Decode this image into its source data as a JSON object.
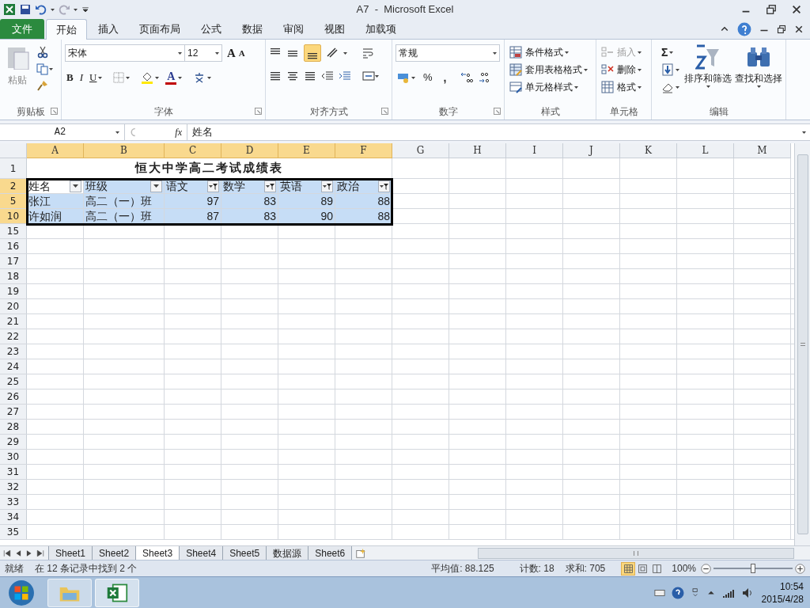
{
  "window": {
    "title": "A7  -  Microsoft Excel"
  },
  "file_tab": "文件",
  "tabs": [
    {
      "label": "开始",
      "selected": true
    },
    {
      "label": "插入",
      "selected": false
    },
    {
      "label": "页面布局",
      "selected": false
    },
    {
      "label": "公式",
      "selected": false
    },
    {
      "label": "数据",
      "selected": false
    },
    {
      "label": "审阅",
      "selected": false
    },
    {
      "label": "视图",
      "selected": false
    },
    {
      "label": "加载项",
      "selected": false
    }
  ],
  "ribbon": {
    "clipboard": {
      "label": "剪贴板",
      "paste": "粘贴"
    },
    "font": {
      "label": "字体",
      "font_name": "宋体",
      "font_size": "12",
      "grow": "A",
      "shrink": "A",
      "bold": "B",
      "italic": "I",
      "underline": "U",
      "font_color": "A"
    },
    "alignment": {
      "label": "对齐方式"
    },
    "number": {
      "label": "数字",
      "format": "常规",
      "percent": "%",
      "comma": ","
    },
    "styles": {
      "label": "样式",
      "items": [
        "条件格式",
        "套用表格格式",
        "单元格样式"
      ]
    },
    "cells": {
      "label": "单元格",
      "items": [
        {
          "label": "插入",
          "disabled": true
        },
        {
          "label": "删除",
          "disabled": false
        },
        {
          "label": "格式",
          "disabled": false
        }
      ]
    },
    "editing": {
      "label": "编辑",
      "sum": "Σ",
      "sort_filter": "排序和筛选",
      "find_select": "查找和选择"
    }
  },
  "formula_bar": {
    "name_box": "A2",
    "fx": "fx",
    "formula": "姓名"
  },
  "sheet": {
    "columns": [
      {
        "label": "A",
        "selected": true
      },
      {
        "label": "B",
        "selected": true
      },
      {
        "label": "C",
        "selected": true
      },
      {
        "label": "D",
        "selected": true
      },
      {
        "label": "E",
        "selected": true
      },
      {
        "label": "F",
        "selected": true
      },
      {
        "label": "G",
        "selected": false
      },
      {
        "label": "H",
        "selected": false
      },
      {
        "label": "I",
        "selected": false
      },
      {
        "label": "J",
        "selected": false
      },
      {
        "label": "K",
        "selected": false
      },
      {
        "label": "L",
        "selected": false
      },
      {
        "label": "M",
        "selected": false
      }
    ],
    "rows": [
      {
        "header": "1",
        "kind": "title",
        "selected": false,
        "title": "恒大中学高二考试成绩表"
      },
      {
        "header": "2",
        "kind": "header",
        "selected": true,
        "cells": [
          {
            "text": "姓名",
            "filtered": false,
            "active": true
          },
          {
            "text": "班级",
            "filtered": false,
            "active": false
          },
          {
            "text": "语文",
            "filtered": true,
            "active": false
          },
          {
            "text": "数学",
            "filtered": true,
            "active": false
          },
          {
            "text": "英语",
            "filtered": true,
            "active": false
          },
          {
            "text": "政治",
            "filtered": true,
            "active": false
          }
        ]
      },
      {
        "header": "5",
        "kind": "data",
        "selected": true,
        "cells": [
          {
            "text": "张江",
            "numeric": false
          },
          {
            "text": "高二（一）班",
            "numeric": false
          },
          {
            "text": "97",
            "numeric": true
          },
          {
            "text": "83",
            "numeric": true
          },
          {
            "text": "89",
            "numeric": true
          },
          {
            "text": "88",
            "numeric": true
          }
        ]
      },
      {
        "header": "10",
        "kind": "data",
        "selected": true,
        "cells": [
          {
            "text": "许如润",
            "numeric": false
          },
          {
            "text": "高二（一）班",
            "numeric": false
          },
          {
            "text": "87",
            "numeric": true
          },
          {
            "text": "83",
            "numeric": true
          },
          {
            "text": "90",
            "numeric": true
          },
          {
            "text": "88",
            "numeric": true
          }
        ]
      },
      {
        "header": "15",
        "kind": "empty",
        "selected": false
      },
      {
        "header": "16",
        "kind": "empty",
        "selected": false
      },
      {
        "header": "17",
        "kind": "empty",
        "selected": false
      },
      {
        "header": "18",
        "kind": "empty",
        "selected": false
      },
      {
        "header": "19",
        "kind": "empty",
        "selected": false
      },
      {
        "header": "20",
        "kind": "empty",
        "selected": false
      },
      {
        "header": "21",
        "kind": "empty",
        "selected": false
      },
      {
        "header": "22",
        "kind": "empty",
        "selected": false
      },
      {
        "header": "23",
        "kind": "empty",
        "selected": false
      },
      {
        "header": "24",
        "kind": "empty",
        "selected": false
      },
      {
        "header": "25",
        "kind": "empty",
        "selected": false
      },
      {
        "header": "26",
        "kind": "empty",
        "selected": false
      },
      {
        "header": "27",
        "kind": "empty",
        "selected": false
      },
      {
        "header": "28",
        "kind": "empty",
        "selected": false
      },
      {
        "header": "29",
        "kind": "empty",
        "selected": false
      },
      {
        "header": "30",
        "kind": "empty",
        "selected": false
      },
      {
        "header": "31",
        "kind": "empty",
        "selected": false
      },
      {
        "header": "32",
        "kind": "empty",
        "selected": false
      },
      {
        "header": "33",
        "kind": "empty",
        "selected": false
      },
      {
        "header": "34",
        "kind": "empty",
        "selected": false
      },
      {
        "header": "35",
        "kind": "empty",
        "selected": false
      }
    ]
  },
  "sheet_tabs": [
    {
      "label": "Sheet1",
      "selected": false
    },
    {
      "label": "Sheet2",
      "selected": false
    },
    {
      "label": "Sheet3",
      "selected": true
    },
    {
      "label": "Sheet4",
      "selected": false
    },
    {
      "label": "Sheet5",
      "selected": false
    },
    {
      "label": "数据源",
      "selected": false
    },
    {
      "label": "Sheet6",
      "selected": false
    }
  ],
  "status_bar": {
    "mode": "就绪",
    "filter_info": "在 12 条记录中找到 2 个",
    "average": "平均值: 88.125",
    "count": "计数: 18",
    "sum": "求和: 705",
    "views": [
      {
        "kind": "normal",
        "selected": true
      },
      {
        "kind": "page_layout",
        "selected": false
      },
      {
        "kind": "page_break",
        "selected": false
      }
    ],
    "zoom": "100%",
    "zoom_level": {
      "level": 0.5
    }
  },
  "taskbar": {
    "time": "10:54",
    "date": "2015/4/28"
  }
}
